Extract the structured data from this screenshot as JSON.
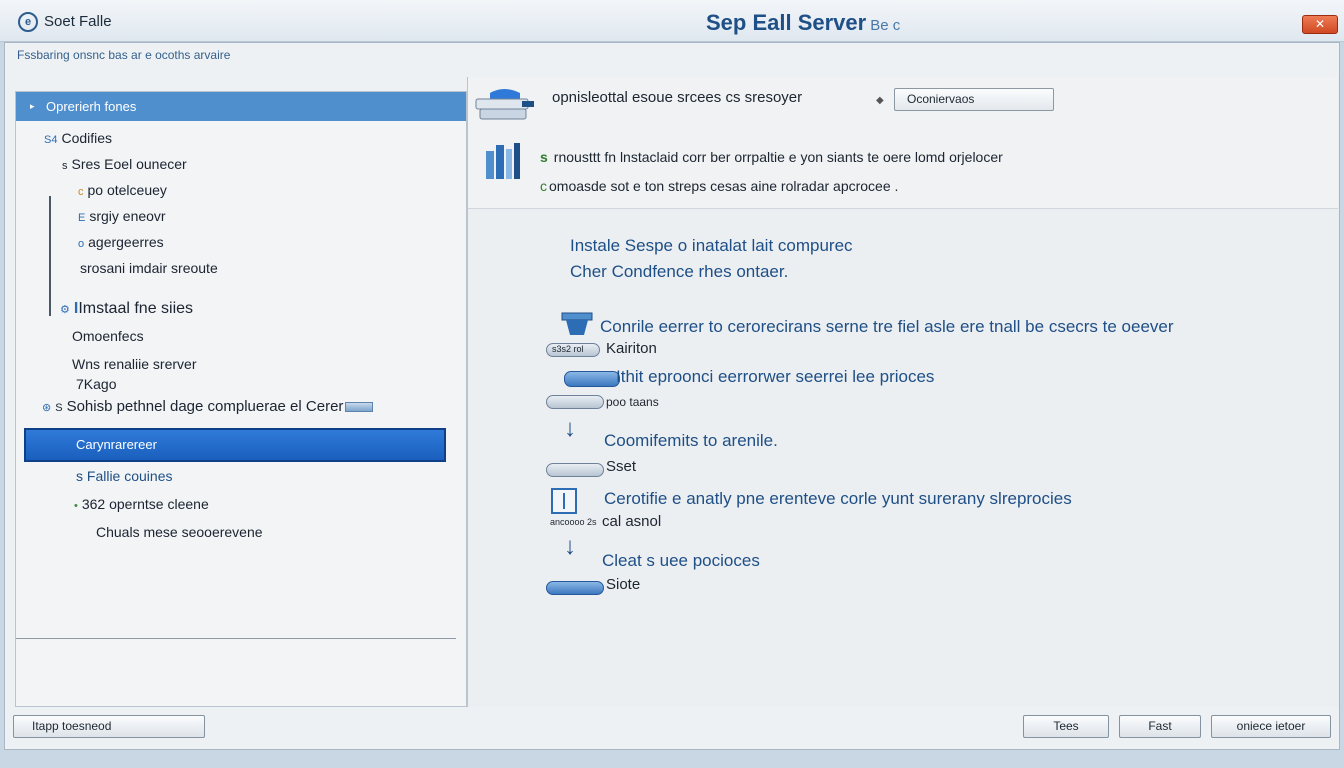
{
  "title_bar": {
    "app_name": "Soet Falle",
    "window_title": "Sep Eall Server",
    "window_title_sub": "Be c",
    "close_label": "✕"
  },
  "breadcrumb": "Fssbaring onsnc bas ar e ocoths arvaire",
  "left_panel": {
    "header": "Oprerierh fones",
    "items": [
      {
        "label": "Codifies",
        "prefix": "S4"
      },
      {
        "label": "Sres Eoel ounecer",
        "prefix": "s"
      },
      {
        "label": "po otelceuey",
        "prefix": "c"
      },
      {
        "label": "srgiy eneovr",
        "prefix": "E"
      },
      {
        "label": "agergeerres",
        "prefix": "o"
      },
      {
        "label": "srosani imdair sreoute",
        "prefix": ""
      },
      {
        "label": "Imstaal fne siies",
        "prefix": "I"
      },
      {
        "label": "Omoenfecs",
        "prefix": ""
      },
      {
        "label": "Wns renaliie srerver",
        "prefix": ""
      },
      {
        "label": "7Kago",
        "prefix": ""
      },
      {
        "label": "Sohisb pethnel dage compluerae el Cerer",
        "prefix": "S"
      },
      {
        "label": "Carynrarereer",
        "prefix": ""
      },
      {
        "label": "s Fallie couines",
        "prefix": ""
      },
      {
        "label": "362 operntse cleene",
        "prefix": ""
      },
      {
        "label": "Chuals mese seooerevene",
        "prefix": ""
      }
    ]
  },
  "right_panel": {
    "top_text": "opnisleottal esoue srcees cs sresoyer",
    "combo_value": "Oconiervaos",
    "info_line1": "rnousttt fn lnstaclaid corr ber orrpaltie e yon siants te oere lomd orjelocer",
    "info_line1_marker": "s",
    "info_line2": "omoasde sot e ton streps cesas aine rolradar apcrocee .",
    "info_line2_marker": "c",
    "heading_1": "Instale Sespe o inatalat lait compurec",
    "heading_2": "Cher Condfence rhes ontaer.",
    "steps": [
      {
        "title": "Conrile eerrer to cerorecirans serne tre fiel asle ere tnall be csecrs te oeever",
        "pill_label": "Kairiton",
        "pill_tag": "s3s2 rol"
      },
      {
        "title": "Ithit eproonci eerrorwer seerrei lee prioces",
        "pill_label": "poo taans",
        "pill_tag": ""
      },
      {
        "title": "Coomifemits to arenile.",
        "pill_label": "Sset",
        "pill_tag": ""
      },
      {
        "title": "Cerotifie e anatly pne erenteve corle yunt surerany slreprocies",
        "pill_label": "cal asnol",
        "pill_tag": "ancoooo 2s"
      },
      {
        "title": "Cleat s uee pocioces",
        "pill_label": "Siote",
        "pill_tag": ""
      }
    ]
  },
  "footer": {
    "left_button": "Itapp toesneod",
    "test_button": "Tees",
    "next_button": "Fast",
    "finish_button": "oniece ietoer"
  },
  "colors": {
    "accent": "#1e4f86",
    "header_blue": "#4f8fce",
    "selected_blue": "#1a5fbe"
  }
}
